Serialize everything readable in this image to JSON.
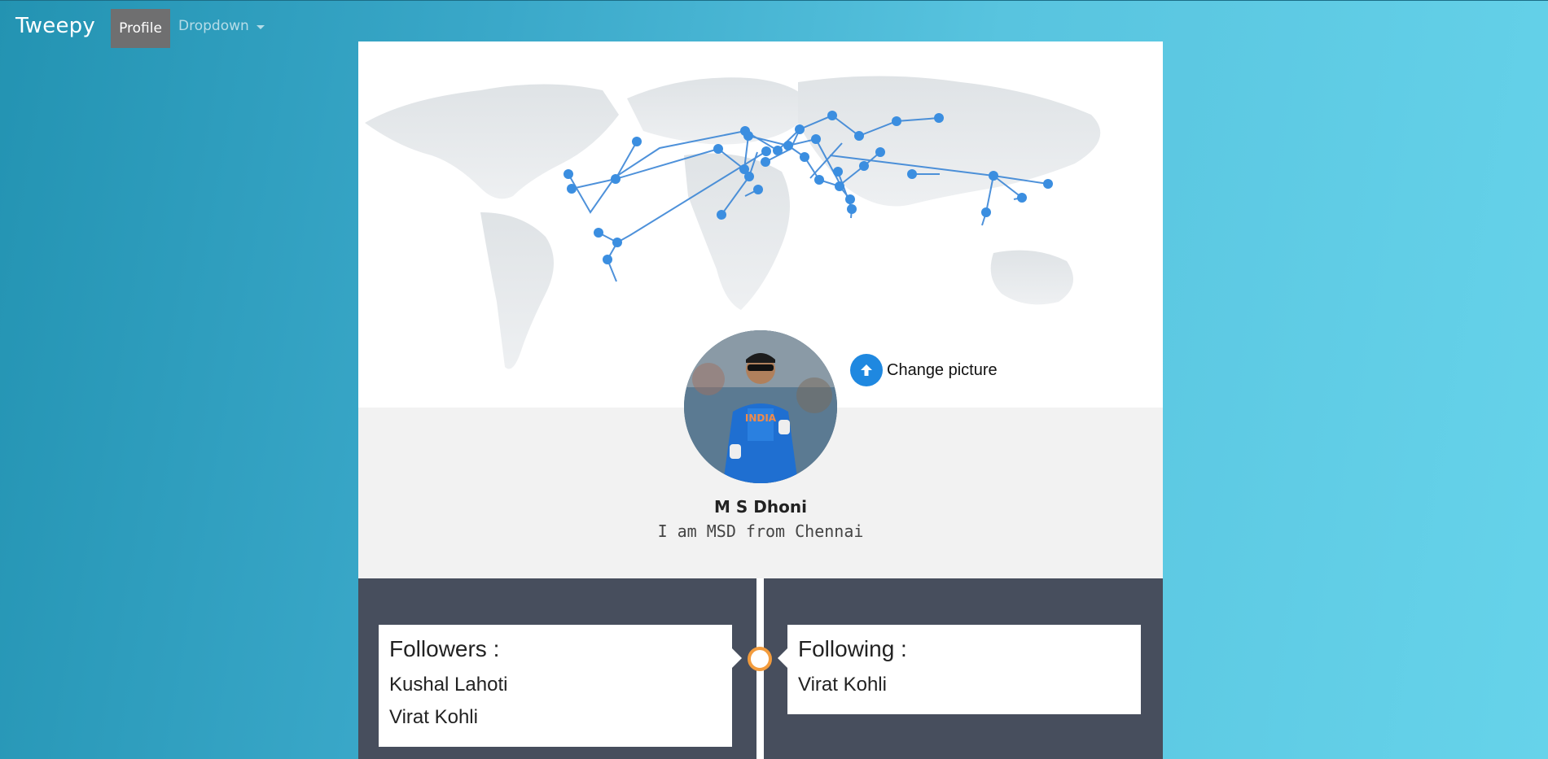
{
  "navbar": {
    "brand": "Tweepy",
    "items": [
      {
        "label": "Profile",
        "active": true
      },
      {
        "label": "Dropdown",
        "has_caret": true
      }
    ]
  },
  "profile": {
    "change_picture_label": "Change picture",
    "name": "M S Dhoni",
    "bio": "I am MSD from Chennai",
    "avatar_icon": "profile-photo"
  },
  "followers": {
    "title": "Followers :",
    "items": [
      "Kushal Lahoti",
      "Virat Kohli"
    ]
  },
  "following": {
    "title": "Following :",
    "items": [
      "Virat Kohli"
    ]
  },
  "colors": {
    "accent": "#1f88e0",
    "stats_bg": "#474e5d",
    "timeline_dot": "#f39c3d",
    "nav_active": "#6f6f70"
  }
}
